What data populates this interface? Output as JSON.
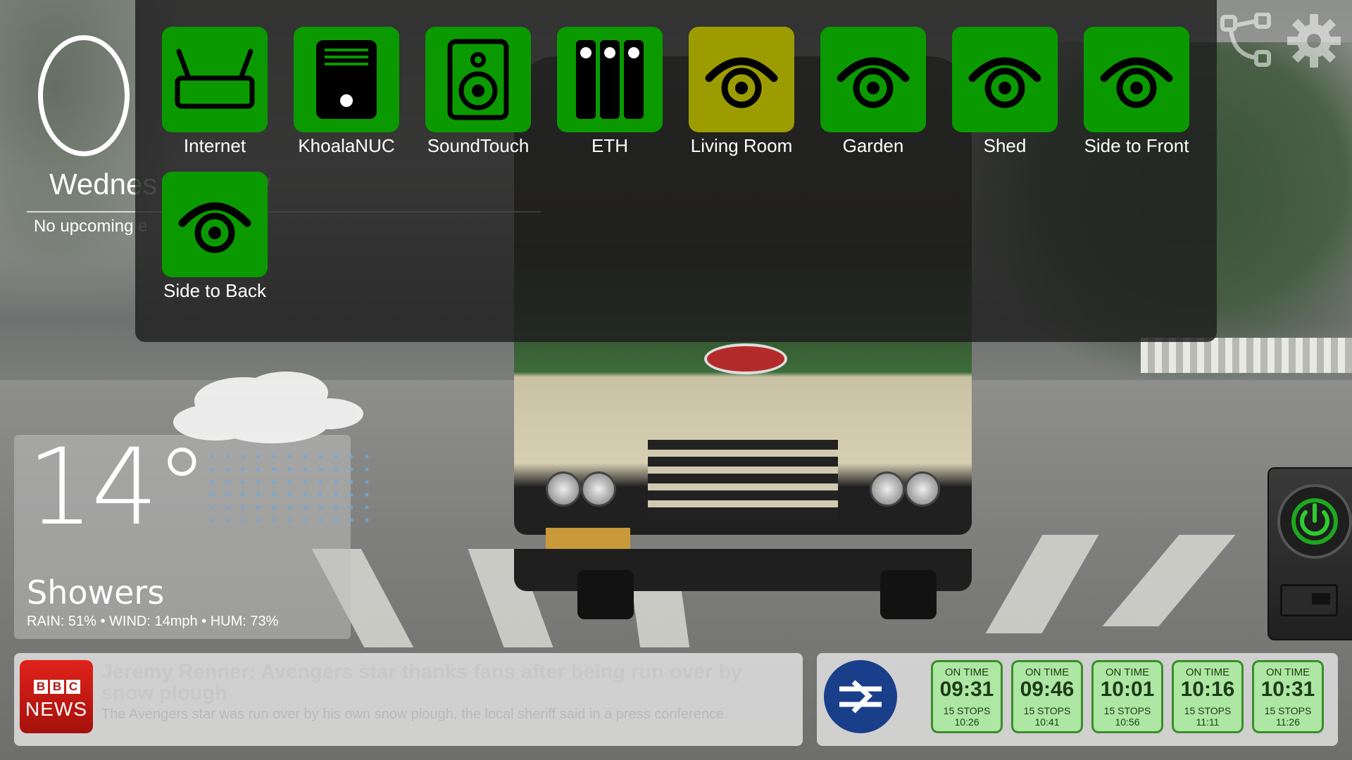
{
  "clock": {
    "date_text": "Wednes   January",
    "upcoming": "No upcoming e"
  },
  "launcher": {
    "tiles": [
      {
        "label": "Internet",
        "icon": "router-icon",
        "state": "on"
      },
      {
        "label": "KhoalaNUC",
        "icon": "pc-tower-icon",
        "state": "on"
      },
      {
        "label": "SoundTouch",
        "icon": "speaker-icon",
        "state": "on"
      },
      {
        "label": "ETH",
        "icon": "network-switch-icon",
        "state": "on"
      },
      {
        "label": "Living Room",
        "icon": "camera-eye-icon",
        "state": "active"
      },
      {
        "label": "Garden",
        "icon": "camera-eye-icon",
        "state": "on"
      },
      {
        "label": "Shed",
        "icon": "camera-eye-icon",
        "state": "on"
      },
      {
        "label": "Side to Front",
        "icon": "camera-eye-icon",
        "state": "on"
      },
      {
        "label": "Side to Back",
        "icon": "camera-eye-icon",
        "state": "on"
      }
    ],
    "colors": {
      "on": "#0a9a00",
      "active": "#9c9c00"
    }
  },
  "toolbar": {
    "icons": [
      "network-icon",
      "gear-icon"
    ]
  },
  "weather": {
    "temperature": "14°",
    "condition": "Showers",
    "stats": "RAIN: 51% • WIND: 14mph • HUM: 73%",
    "icon": "cloud-rain-icon"
  },
  "power": {
    "icon": "power-icon"
  },
  "news": {
    "logo_letters": [
      "B",
      "B",
      "C"
    ],
    "logo_word": "NEWS",
    "headline": "Jeremy Renner: Avengers star thanks fans after being run over by snow plough",
    "summary": "The Avengers star was run over by his own snow plough, the local sheriff said in a press conference."
  },
  "trains": {
    "icon": "national-rail-icon",
    "departures": [
      {
        "status": "ON TIME",
        "time": "09:31",
        "stops": "15 STOPS",
        "arrive": "10:26"
      },
      {
        "status": "ON TIME",
        "time": "09:46",
        "stops": "15 STOPS",
        "arrive": "10:41"
      },
      {
        "status": "ON TIME",
        "time": "10:01",
        "stops": "15 STOPS",
        "arrive": "10:56"
      },
      {
        "status": "ON TIME",
        "time": "10:16",
        "stops": "15 STOPS",
        "arrive": "11:11"
      },
      {
        "status": "ON TIME",
        "time": "10:31",
        "stops": "15 STOPS",
        "arrive": "11:26"
      }
    ]
  }
}
